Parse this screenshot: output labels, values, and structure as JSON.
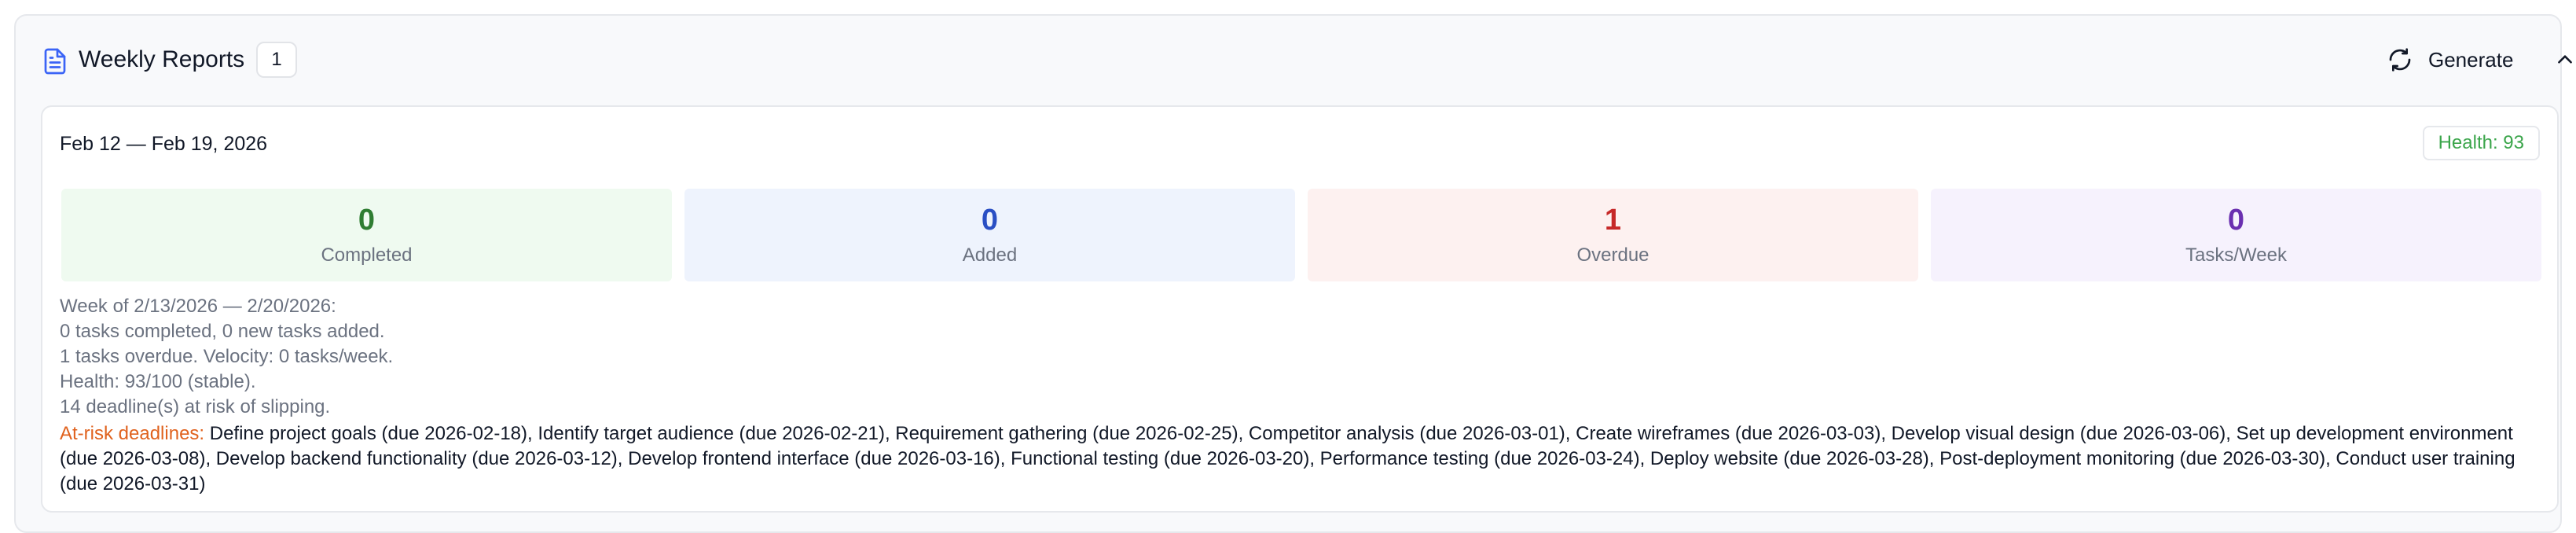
{
  "header": {
    "title": "Weekly Reports",
    "count": "1",
    "generate_label": "Generate",
    "icons": {
      "doc": "document-icon",
      "refresh": "refresh-icon",
      "collapse": "chevron-up-icon"
    },
    "accent_color": "#3b64f6"
  },
  "report": {
    "date_range": "Feb 12 — Feb 19, 2026",
    "health_label": "Health: 93",
    "health_color": "#3aa54a",
    "stats": [
      {
        "value": "0",
        "label": "Completed",
        "color": "#2f7d32",
        "bg": "#effaf0"
      },
      {
        "value": "0",
        "label": "Added",
        "color": "#2a4fc4",
        "bg": "#eef3fd"
      },
      {
        "value": "1",
        "label": "Overdue",
        "color": "#c62828",
        "bg": "#fdf1f0"
      },
      {
        "value": "0",
        "label": "Tasks/Week",
        "color": "#6a2fb0",
        "bg": "#f6f2fd"
      }
    ],
    "summary_lines": [
      "Week of 2/13/2026 — 2/20/2026:",
      "0 tasks completed, 0 new tasks added.",
      "1 tasks overdue. Velocity: 0 tasks/week.",
      "Health: 93/100 (stable).",
      "14 deadline(s) at risk of slipping."
    ],
    "at_risk_label": "At-risk deadlines:",
    "at_risk_text": "Define project goals (due 2026-02-18), Identify target audience (due 2026-02-21), Requirement gathering (due 2026-02-25), Competitor analysis (due 2026-03-01), Create wireframes (due 2026-03-03), Develop visual design (due 2026-03-06), Set up development environment (due 2026-03-08), Develop backend functionality (due 2026-03-12), Develop frontend interface (due 2026-03-16), Functional testing (due 2026-03-20), Performance testing (due 2026-03-24), Deploy website (due 2026-03-28), Post-deployment monitoring (due 2026-03-30), Conduct user training (due 2026-03-31)",
    "at_risk_color": "#e0621e"
  }
}
